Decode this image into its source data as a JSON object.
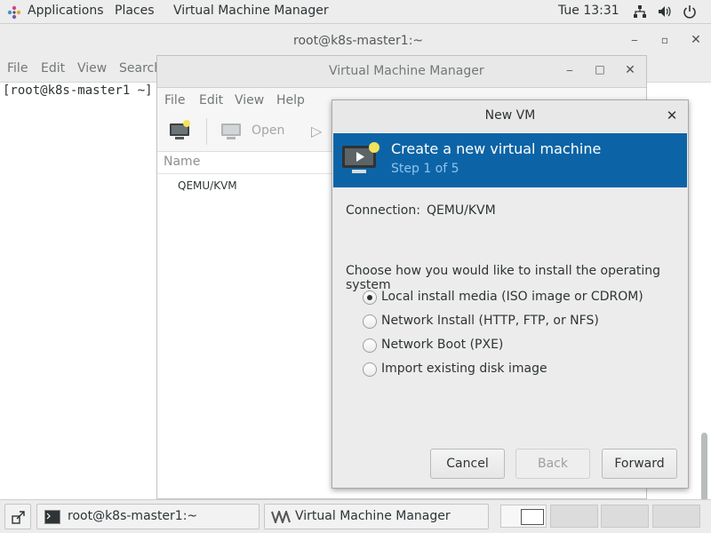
{
  "topbar": {
    "applications": "Applications",
    "places": "Places",
    "active_app": "Virtual Machine Manager",
    "clock": "Tue 13:31"
  },
  "terminal": {
    "title": "root@k8s-master1:~",
    "menu": [
      "File",
      "Edit",
      "View",
      "Search"
    ],
    "prompt": "[root@k8s-master1 ~]"
  },
  "vmm": {
    "title": "Virtual Machine Manager",
    "menu": [
      "File",
      "Edit",
      "View",
      "Help"
    ],
    "toolbar_open": "Open",
    "column_name": "Name",
    "rows": [
      "QEMU/KVM"
    ]
  },
  "newvm": {
    "title": "New VM",
    "banner_title": "Create a new virtual machine",
    "banner_step": "Step 1 of 5",
    "connection_label": "Connection:",
    "connection_value": "QEMU/KVM",
    "question": "Choose how you would like to install the operating system",
    "options": [
      "Local install media (ISO image or CDROM)",
      "Network Install (HTTP, FTP, or NFS)",
      "Network Boot (PXE)",
      "Import existing disk image"
    ],
    "selected_option": 0,
    "cancel": "Cancel",
    "back": "Back",
    "forward": "Forward",
    "accent": "#0c64a6"
  },
  "taskbar": {
    "items": [
      "root@k8s-master1:~",
      "Virtual Machine Manager"
    ]
  }
}
